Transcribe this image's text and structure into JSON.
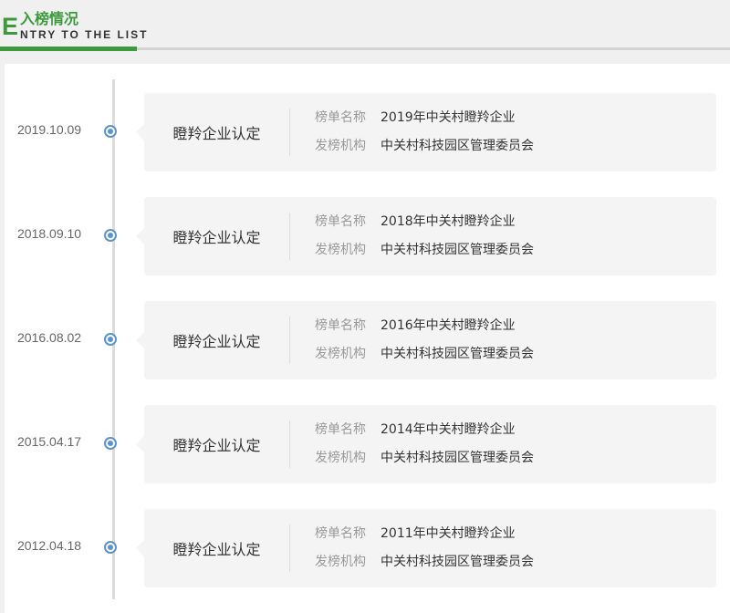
{
  "header": {
    "initial": "E",
    "title": "入榜情况",
    "subtitle": "NTRY TO THE LIST"
  },
  "colors": {
    "accent_green": "#3c9a3d",
    "timeline_dot": "#5a93cf"
  },
  "entries": [
    {
      "date": "2019.10.09",
      "title": "瞪羚企业认定",
      "label_name": "榜单名称",
      "list_name": "2019年中关村瞪羚企业",
      "label_issuer": "发榜机构",
      "issuer": "中关村科技园区管理委员会"
    },
    {
      "date": "2018.09.10",
      "title": "瞪羚企业认定",
      "label_name": "榜单名称",
      "list_name": "2018年中关村瞪羚企业",
      "label_issuer": "发榜机构",
      "issuer": "中关村科技园区管理委员会"
    },
    {
      "date": "2016.08.02",
      "title": "瞪羚企业认定",
      "label_name": "榜单名称",
      "list_name": "2016年中关村瞪羚企业",
      "label_issuer": "发榜机构",
      "issuer": "中关村科技园区管理委员会"
    },
    {
      "date": "2015.04.17",
      "title": "瞪羚企业认定",
      "label_name": "榜单名称",
      "list_name": "2014年中关村瞪羚企业",
      "label_issuer": "发榜机构",
      "issuer": "中关村科技园区管理委员会"
    },
    {
      "date": "2012.04.18",
      "title": "瞪羚企业认定",
      "label_name": "榜单名称",
      "list_name": "2011年中关村瞪羚企业",
      "label_issuer": "发榜机构",
      "issuer": "中关村科技园区管理委员会"
    }
  ]
}
